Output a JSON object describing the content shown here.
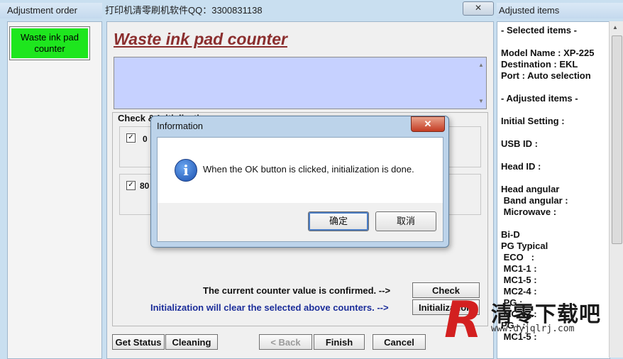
{
  "left_pane": {
    "title": "Adjustment order",
    "items": [
      {
        "label": "Waste ink pad counter",
        "color": "#1ee61e"
      }
    ]
  },
  "main_window": {
    "title": "打印机清零刷机软件QQ：3300831138",
    "close_label": "✕",
    "heading": "Waste ink pad counter",
    "group_label": "Check & Initialization",
    "rows": [
      {
        "checked": true,
        "counter": "0"
      },
      {
        "checked": true,
        "counter": "80"
      }
    ],
    "confirm_text": "The current counter value is confirmed. -->",
    "check_label": "Check",
    "init_text": "Initialization will clear the selected above counters. -->",
    "init_label": "Initialization",
    "bottom_buttons": {
      "get_status": "Get Status",
      "cleaning": "Cleaning",
      "back": "< Back",
      "finish": "Finish",
      "cancel": "Cancel"
    }
  },
  "right_pane": {
    "title": "Adjusted items",
    "lines": [
      "- Selected items -",
      "",
      "Model Name : XP-225",
      "Destination : EKL",
      "Port : Auto selection",
      "",
      "- Adjusted items -",
      "",
      "Initial Setting :",
      "",
      "USB ID :",
      "",
      "Head ID :",
      "",
      "Head angular",
      " Band angular :",
      " Microwave :",
      "",
      "Bi-D",
      "PG Typical",
      " ECO   :",
      " MC1-1 :",
      " MC1-5 :",
      " MC2-4 :",
      " PG :",
      " MC2-3 :",
      "PG - :",
      " MC1-5 :"
    ]
  },
  "dialog": {
    "title": "Information",
    "close_label": "✕",
    "icon": "info-icon",
    "message": "When the OK button is clicked, initialization is done.",
    "ok_label": "确定",
    "cancel_label": "取消"
  },
  "watermark": {
    "logo_letter": "R",
    "name": "清零下载吧",
    "url": "www.dyjqlrj.com"
  }
}
